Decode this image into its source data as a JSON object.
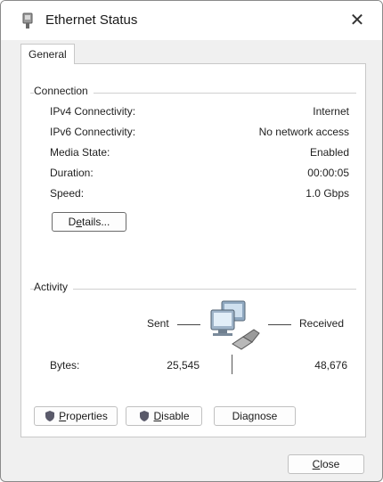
{
  "window": {
    "title": "Ethernet Status",
    "close_glyph": "✕"
  },
  "tabs": [
    {
      "label": "General"
    }
  ],
  "connection": {
    "heading": "Connection",
    "rows": [
      {
        "label": "IPv4 Connectivity:",
        "value": "Internet"
      },
      {
        "label": "IPv6 Connectivity:",
        "value": "No network access"
      },
      {
        "label": "Media State:",
        "value": "Enabled"
      },
      {
        "label": "Duration:",
        "value": "00:00:05"
      },
      {
        "label": "Speed:",
        "value": "1.0 Gbps"
      }
    ],
    "details_button": {
      "mnemonic": "D",
      "pre": "",
      "u": "e",
      "post": "tails..."
    }
  },
  "activity": {
    "heading": "Activity",
    "sent_label": "Sent",
    "received_label": "Received",
    "bytes_label": "Bytes:",
    "bytes_sent": "25,545",
    "bytes_received": "48,676"
  },
  "buttons": {
    "properties": {
      "u": "P",
      "rest": "roperties"
    },
    "disable": {
      "u": "D",
      "rest": "isable"
    },
    "diagnose": {
      "label": "Diagnose"
    },
    "close": {
      "u": "C",
      "rest": "lose"
    }
  },
  "icons": {
    "title_icon": "ethernet-adapter-icon",
    "network_icon": "network-computers-icon",
    "shield_icon": "uac-shield-icon"
  }
}
